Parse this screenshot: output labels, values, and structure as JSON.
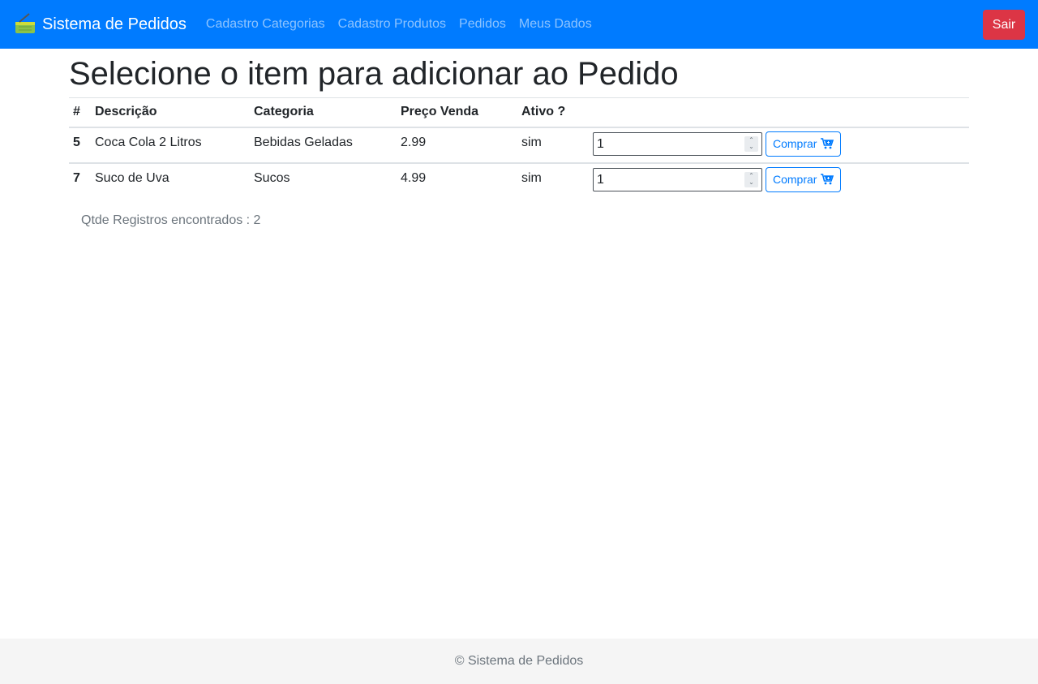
{
  "navbar": {
    "brand": "Sistema de Pedidos",
    "links": [
      "Cadastro Categorias",
      "Cadastro Produtos",
      "Pedidos",
      "Meus Dados"
    ],
    "logout": "Sair",
    "color": "#007bff"
  },
  "page": {
    "title": "Selecione o item para adicionar ao Pedido"
  },
  "table": {
    "headers": [
      "#",
      "Descrição",
      "Categoria",
      "Preço Venda",
      "Ativo ?"
    ],
    "rows": [
      {
        "id": "5",
        "descricao": "Coca Cola 2 Litros",
        "categoria": "Bebidas Geladas",
        "preco": "2.99",
        "ativo": "sim",
        "qty": "1",
        "buy_label": "Comprar"
      },
      {
        "id": "7",
        "descricao": "Suco de Uva",
        "categoria": "Sucos",
        "preco": "4.99",
        "ativo": "sim",
        "qty": "1",
        "buy_label": "Comprar"
      }
    ]
  },
  "records_text": "Qtde Registros encontrados : 2",
  "footer": {
    "text": "© Sistema de Pedidos"
  },
  "icons": {
    "brand": "shopping-basket-icon",
    "buy": "cart-plus-icon"
  }
}
